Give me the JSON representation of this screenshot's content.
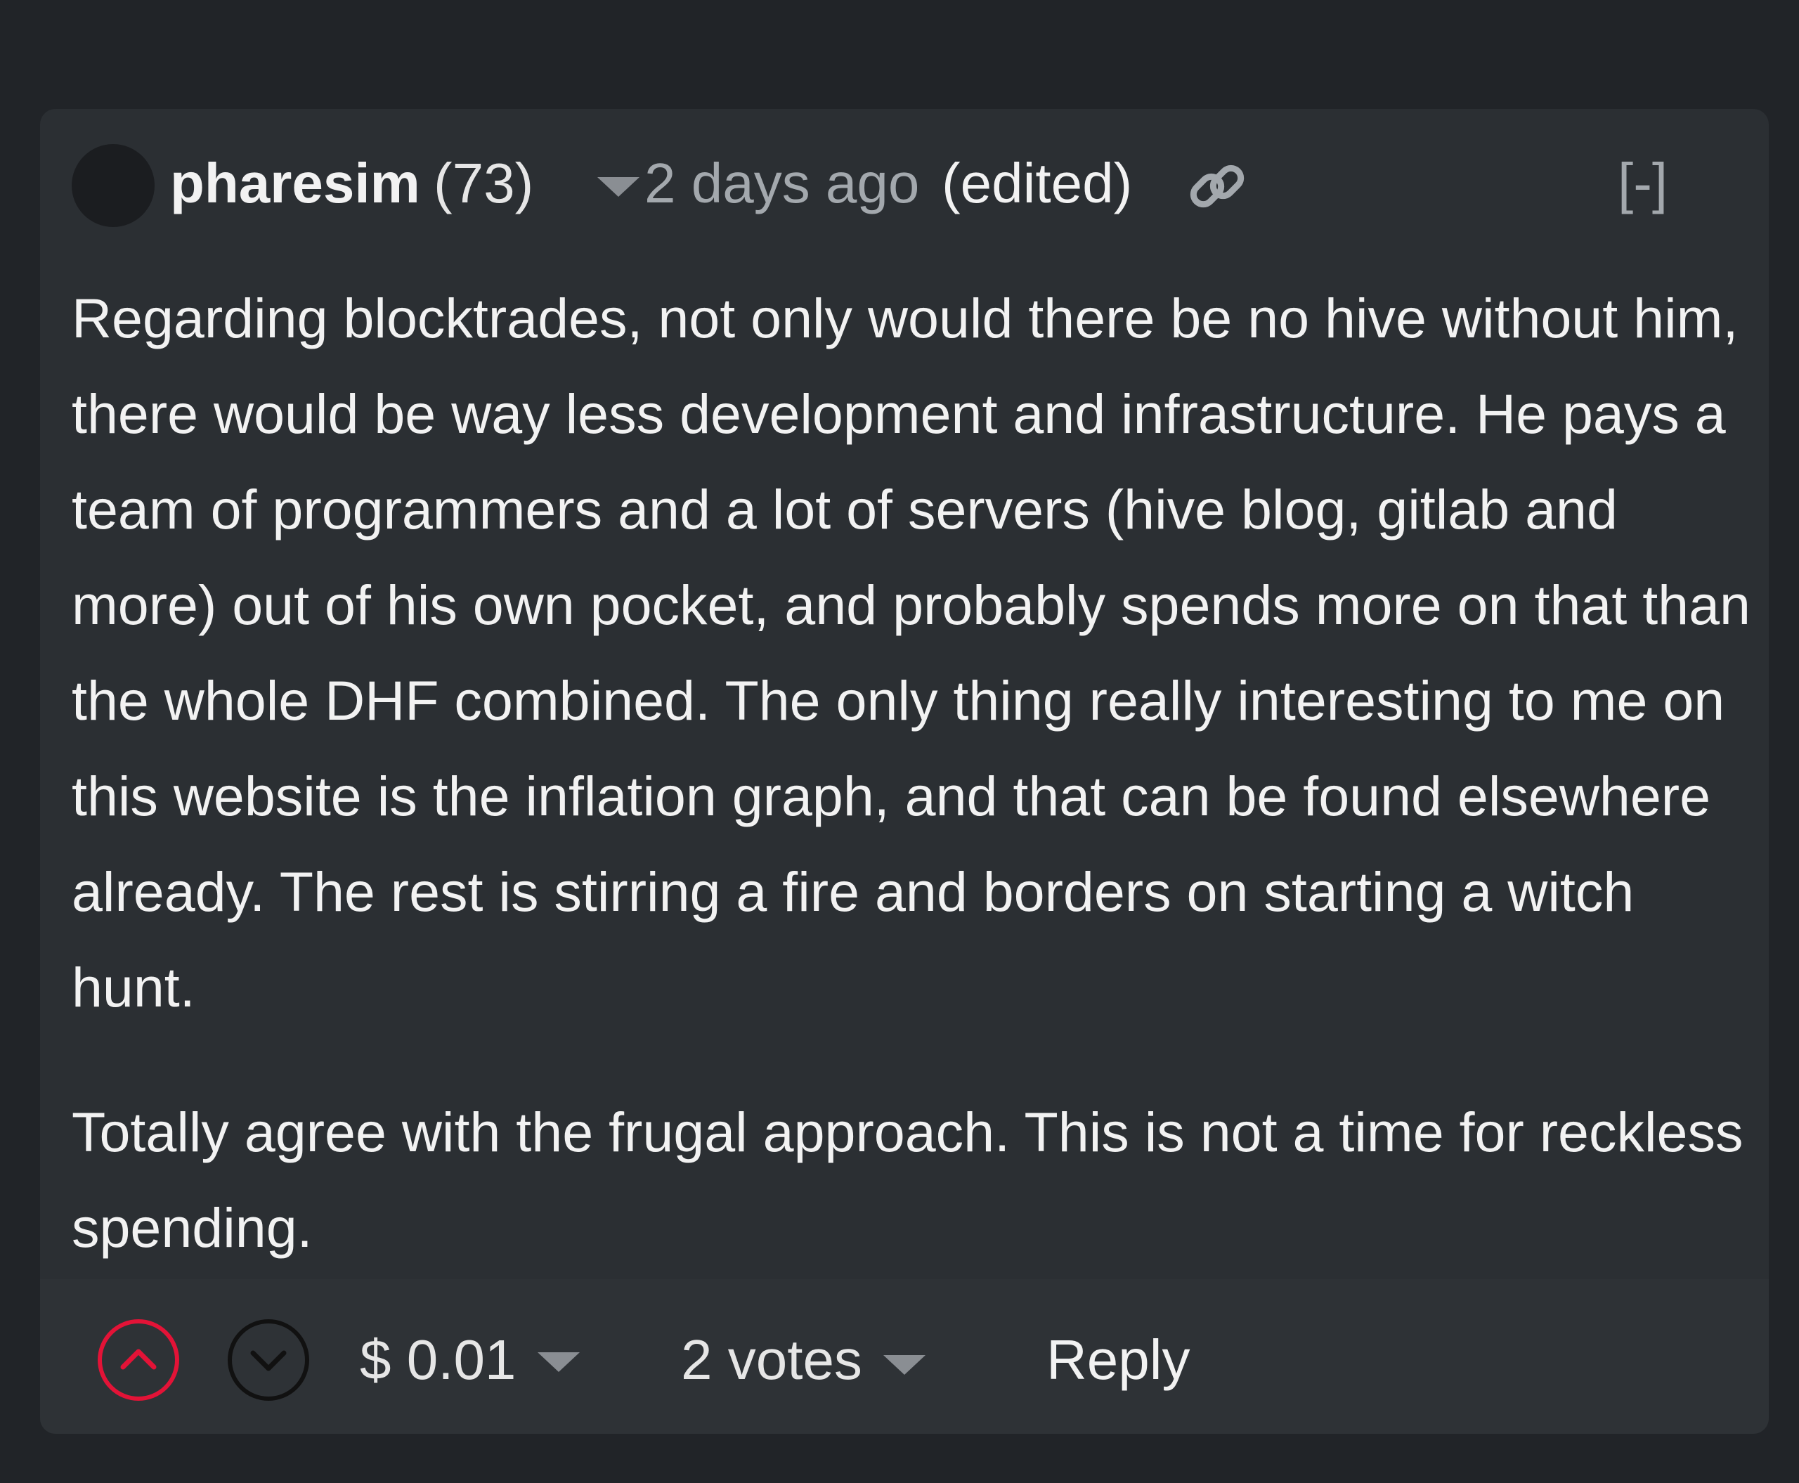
{
  "comment": {
    "author": "pharesim",
    "reputation": "(73)",
    "time": "2 days ago",
    "edited": "(edited)",
    "collapse_label": "[-]",
    "paragraphs": [
      "Regarding blocktrades, not only would there be no hive without him, there would be way less development and infrastructure. He pays a team of programmers and a lot of servers (hive blog, gitlab and more) out of his own pocket, and probably spends more on that than the whole DHF combined. The only thing really interesting to me on this website is the inflation graph, and that can be found elsewhere already. The rest is stirring a fire and borders on starting a witch hunt.",
      "Totally agree with the frugal approach. This is not a time for reckless spending."
    ]
  },
  "footer": {
    "payout": "$ 0.01",
    "votes": "2 votes",
    "reply_label": "Reply"
  },
  "colors": {
    "upvote": "#e31337",
    "downvote": "#111111",
    "card_bg": "#2b2f33",
    "page_bg": "#212428"
  },
  "icons": {
    "upvote": "chevron-up-circle-icon",
    "downvote": "chevron-down-circle-icon",
    "permalink": "link-icon",
    "dropdown": "caret-down-icon"
  }
}
